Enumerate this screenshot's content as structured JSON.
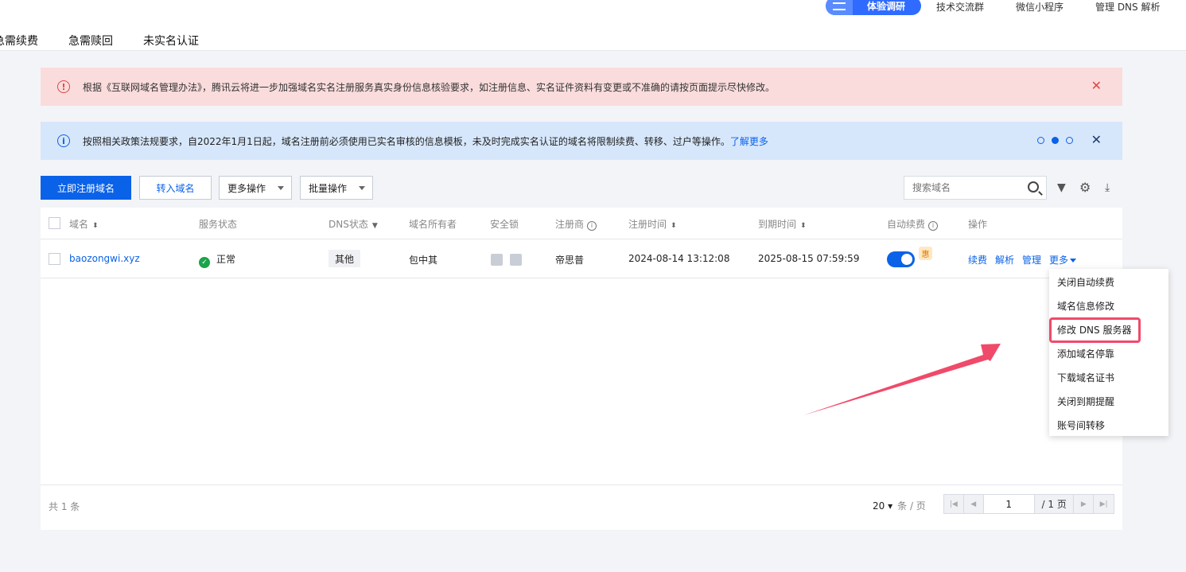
{
  "top_links": {
    "survey": "体验调研",
    "tech_group": "技术交流群",
    "wechat_app": "微信小程序",
    "manage_dns": "管理 DNS 解析"
  },
  "tabs": [
    "急需续费",
    "急需赎回",
    "未实名认证"
  ],
  "alerts": {
    "red": "根据《互联网域名管理办法》，腾讯云将进一步加强域名实名注册服务真实身份信息核验要求，如注册信息、实名证件资料有变更或不准确的请按页面提示尽快修改。",
    "blue": "按照相关政策法规要求，自2022年1月1日起，域名注册前必须使用已实名审核的信息模板，未及时完成实名认证的域名将限制续费、转移、过户等操作。",
    "blue_link": "了解更多"
  },
  "toolbar": {
    "register": "立即注册域名",
    "transfer_in": "转入域名",
    "more_ops": "更多操作",
    "batch_ops": "批量操作",
    "search_placeholder": "搜索域名"
  },
  "table": {
    "headers": {
      "domain": "域名",
      "status": "服务状态",
      "dns": "DNS状态",
      "owner": "域名所有者",
      "lock": "安全锁",
      "registrar": "注册商",
      "reg_time": "注册时间",
      "exp_time": "到期时间",
      "auto_renew": "自动续费",
      "actions": "操作"
    },
    "rows": [
      {
        "domain": "baozongwi.xyz",
        "status": "正常",
        "dns": "其他",
        "owner": "包中其",
        "registrar": "帝思普",
        "reg_time": "2024-08-14 13:12:08",
        "exp_time": "2025-08-15 07:59:59",
        "auto_renew": true,
        "badge": "惠"
      }
    ],
    "actions": {
      "renew": "续费",
      "resolve": "解析",
      "manage": "管理",
      "more": "更多"
    }
  },
  "footer": {
    "total": "共 1 条",
    "page_size": "20",
    "page_size_unit": "条 / 页",
    "page": "1",
    "page_total": "/ 1 页"
  },
  "dropdown": [
    "关闭自动续费",
    "域名信息修改",
    "修改 DNS 服务器",
    "添加域名停靠",
    "下载域名证书",
    "关闭到期提醒",
    "账号间转移"
  ],
  "colors": {
    "primary": "#0a62e8",
    "highlight": "#f04a6a"
  }
}
